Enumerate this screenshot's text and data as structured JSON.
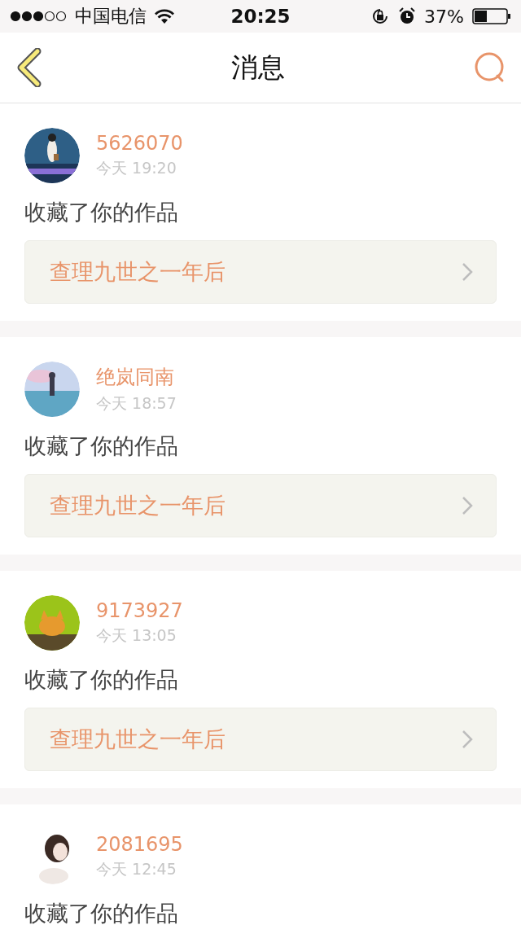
{
  "status_bar": {
    "carrier": "中国电信",
    "time": "20:25",
    "battery": "37%"
  },
  "nav": {
    "title": "消息"
  },
  "messages": [
    {
      "user": "5626070",
      "time": "今天 19:20",
      "action": "收藏了你的作品",
      "work": "查理九世之一年后"
    },
    {
      "user": "绝岚同南",
      "time": "今天 18:57",
      "action": "收藏了你的作品",
      "work": "查理九世之一年后"
    },
    {
      "user": "9173927",
      "time": "今天 13:05",
      "action": "收藏了你的作品",
      "work": "查理九世之一年后"
    },
    {
      "user": "2081695",
      "time": "今天 12:45",
      "action": "收藏了你的作品"
    }
  ]
}
